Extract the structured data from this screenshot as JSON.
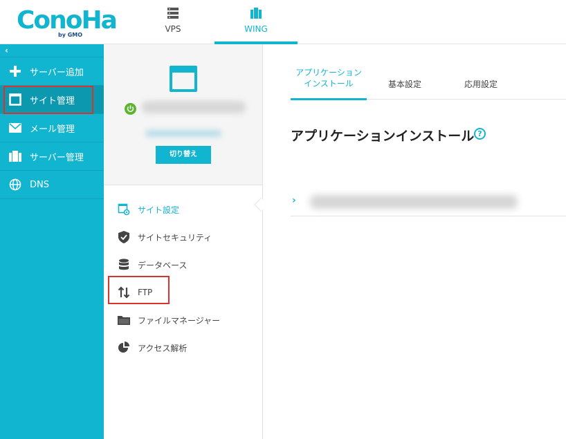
{
  "header": {
    "logo_text": "ConoHa",
    "logo_sub": "by GMO",
    "nav": [
      {
        "label": "VPS",
        "icon": "server-stack-icon"
      },
      {
        "label": "WING",
        "icon": "wing-server-icon"
      }
    ]
  },
  "sidebar": {
    "collapse_label": "‹",
    "items": [
      {
        "label": "サーバー追加",
        "icon": "plus-icon"
      },
      {
        "label": "サイト管理",
        "icon": "window-icon"
      },
      {
        "label": "メール管理",
        "icon": "mail-icon"
      },
      {
        "label": "サーバー管理",
        "icon": "server-icon"
      },
      {
        "label": "DNS",
        "icon": "globe-icon"
      }
    ]
  },
  "site_panel": {
    "switch_label": "切り替え",
    "menu": [
      {
        "label": "サイト設定",
        "icon": "site-settings-icon"
      },
      {
        "label": "サイトセキュリティ",
        "icon": "shield-check-icon"
      },
      {
        "label": "データベース",
        "icon": "database-icon"
      },
      {
        "label": "FTP",
        "icon": "transfer-arrows-icon"
      },
      {
        "label": "ファイルマネージャー",
        "icon": "folder-icon"
      },
      {
        "label": "アクセス解析",
        "icon": "pie-chart-icon"
      }
    ]
  },
  "content": {
    "tabs": [
      {
        "label_line1": "アプリケーション",
        "label_line2": "インストール"
      },
      {
        "label": "基本設定"
      },
      {
        "label": "応用設定"
      }
    ],
    "heading": "アプリケーションインストール",
    "help_glyph": "?",
    "row_chevron": "›"
  },
  "colors": {
    "accent": "#12b5cf",
    "sidebar_active": "#0c99b0",
    "highlight_box": "#d9322f",
    "power_green": "#5cb531"
  }
}
